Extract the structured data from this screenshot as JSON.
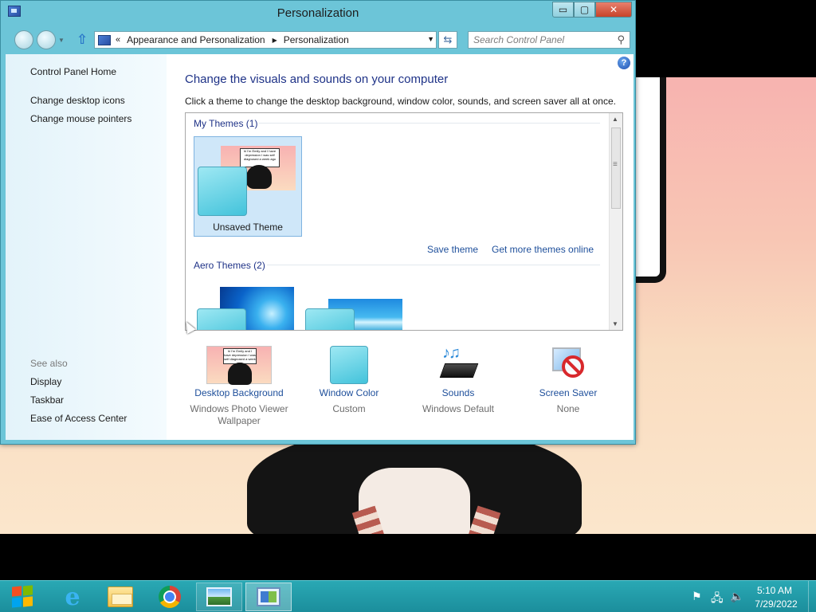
{
  "window": {
    "title": "Personalization",
    "controls": {
      "minimize": "▭",
      "maximize": "▢",
      "close": "✕"
    }
  },
  "navigation": {
    "back_icon": "back-arrow-icon",
    "forward_icon": "forward-arrow-icon",
    "up_icon": "up-arrow-icon",
    "chevron": "«",
    "breadcrumbs": [
      "Appearance and Personalization",
      "Personalization"
    ],
    "search_placeholder": "Search Control Panel"
  },
  "sidebar": {
    "links": [
      "Control Panel Home",
      "Change desktop icons",
      "Change mouse pointers"
    ],
    "see_also_title": "See also",
    "see_also": [
      "Display",
      "Taskbar",
      "Ease of Access Center"
    ]
  },
  "main": {
    "heading": "Change the visuals and sounds on your computer",
    "description": "Click a theme to change the desktop background, window color, sounds, and screen saver all at once.",
    "groups": {
      "my_themes": "My Themes (1)",
      "aero_themes": "Aero Themes (2)"
    },
    "unsaved_theme_name": "Unsaved Theme",
    "wallpaper_bubble_text": "hi I'm Emily and I have depression I was self diagnosed a week ago",
    "save_theme": "Save theme",
    "more_themes": "Get more themes online"
  },
  "bottom_items": [
    {
      "label": "Desktop Background",
      "sub": "Windows Photo Viewer Wallpaper",
      "icon": "desktop-background-icon"
    },
    {
      "label": "Window Color",
      "sub": "Custom",
      "icon": "window-color-icon"
    },
    {
      "label": "Sounds",
      "sub": "Windows Default",
      "icon": "sounds-icon"
    },
    {
      "label": "Screen Saver",
      "sub": "None",
      "icon": "screen-saver-icon"
    }
  ],
  "taskbar": {
    "apps": [
      "Internet Explorer",
      "File Explorer",
      "Google Chrome",
      "Windows Photo Viewer",
      "Control Panel"
    ],
    "clock_time": "5:10 AM",
    "clock_date": "7/29/2022"
  },
  "colors": {
    "window_frame": "#6cc5d8",
    "taskbar": "#1b8e9c",
    "link": "#1e4f9b",
    "heading": "#1e3287"
  }
}
